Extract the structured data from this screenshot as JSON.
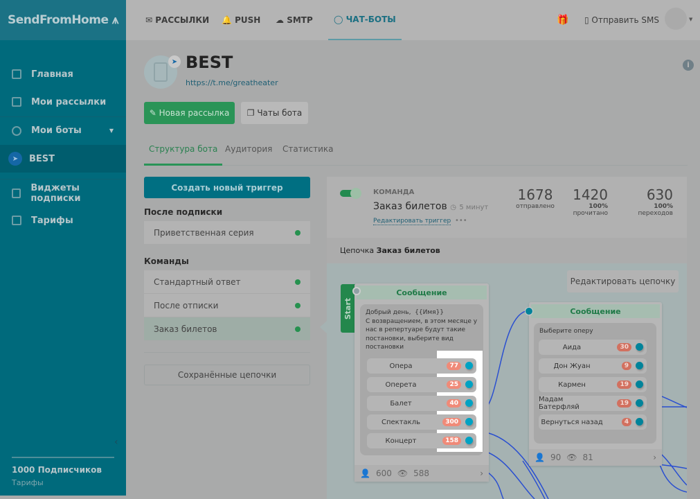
{
  "app": {
    "logo": "SendFromHome"
  },
  "topnav": {
    "items": [
      {
        "label": "РАССЫЛКИ",
        "icon": "envelope-icon"
      },
      {
        "label": "PUSH",
        "icon": "bell-icon"
      },
      {
        "label": "SMTP",
        "icon": "cloud-icon"
      },
      {
        "label": "ЧАТ-БОТЫ",
        "icon": "chat-icon",
        "active": true
      }
    ],
    "send_sms": "Отправить SMS"
  },
  "sidebar": {
    "items": [
      {
        "label": "Главная"
      },
      {
        "label": "Мои рассылки"
      },
      {
        "label": "Мои боты"
      },
      {
        "label": "BEST",
        "active": true
      },
      {
        "label": "Виджеты подписки"
      },
      {
        "label": "Тарифы"
      }
    ],
    "subscribers": "1000 Подписчиков",
    "tariffs": "Тарифы"
  },
  "bot": {
    "name": "BEST",
    "link": "https://t.me/greatheater",
    "new_mailing": "Новая рассылка",
    "bot_chats": "Чаты бота"
  },
  "tabs": [
    {
      "label": "Структура бота",
      "active": true
    },
    {
      "label": "Аудитория"
    },
    {
      "label": "Статистика"
    }
  ],
  "triggers": {
    "create": "Создать новый триггер",
    "after_sub_title": "После подписки",
    "after_sub": [
      "Приветственная серия"
    ],
    "commands_title": "Команды",
    "commands": [
      "Стандартный ответ",
      "После отписки",
      "Заказ билетов"
    ],
    "saved": "Сохранённые цепочки"
  },
  "command": {
    "type": "КОМАНДА",
    "name": "Заказ билетов",
    "delay": "5 минут",
    "edit": "Редактировать триггер",
    "stats": [
      {
        "value": "1678",
        "pct": "",
        "label": "отправлено"
      },
      {
        "value": "1420",
        "pct": "100%",
        "label": "прочитано"
      },
      {
        "value": "630",
        "pct": "100%",
        "label": "переходов"
      }
    ]
  },
  "chain": {
    "prefix": "Цепочка ",
    "name": "Заказ билетов",
    "edit": "Редактировать цепочку",
    "start": "Start",
    "node1": {
      "title": "Сообщение",
      "text": "Добрый день,  {{Имя}}\nС возвращением, в этом месяце у нас в репертуаре будут такие постановки, выберите вид постановки",
      "buttons": [
        {
          "label": "Опера",
          "count": "77"
        },
        {
          "label": "Оперета",
          "count": "25"
        },
        {
          "label": "Балет",
          "count": "40"
        },
        {
          "label": "Спектакль",
          "count": "300"
        },
        {
          "label": "Концерт",
          "count": "158"
        }
      ],
      "users": "600",
      "views": "588"
    },
    "node2": {
      "title": "Сообщение",
      "text": "Выберите оперу",
      "buttons": [
        {
          "label": "Аида",
          "count": "30"
        },
        {
          "label": "Дон Жуан",
          "count": "9"
        },
        {
          "label": "Кармен",
          "count": "19"
        },
        {
          "label": "Мадам Батерфляй",
          "count": "19"
        },
        {
          "label": "Вернуться назад",
          "count": "4"
        }
      ],
      "users": "90",
      "views": "81"
    }
  }
}
